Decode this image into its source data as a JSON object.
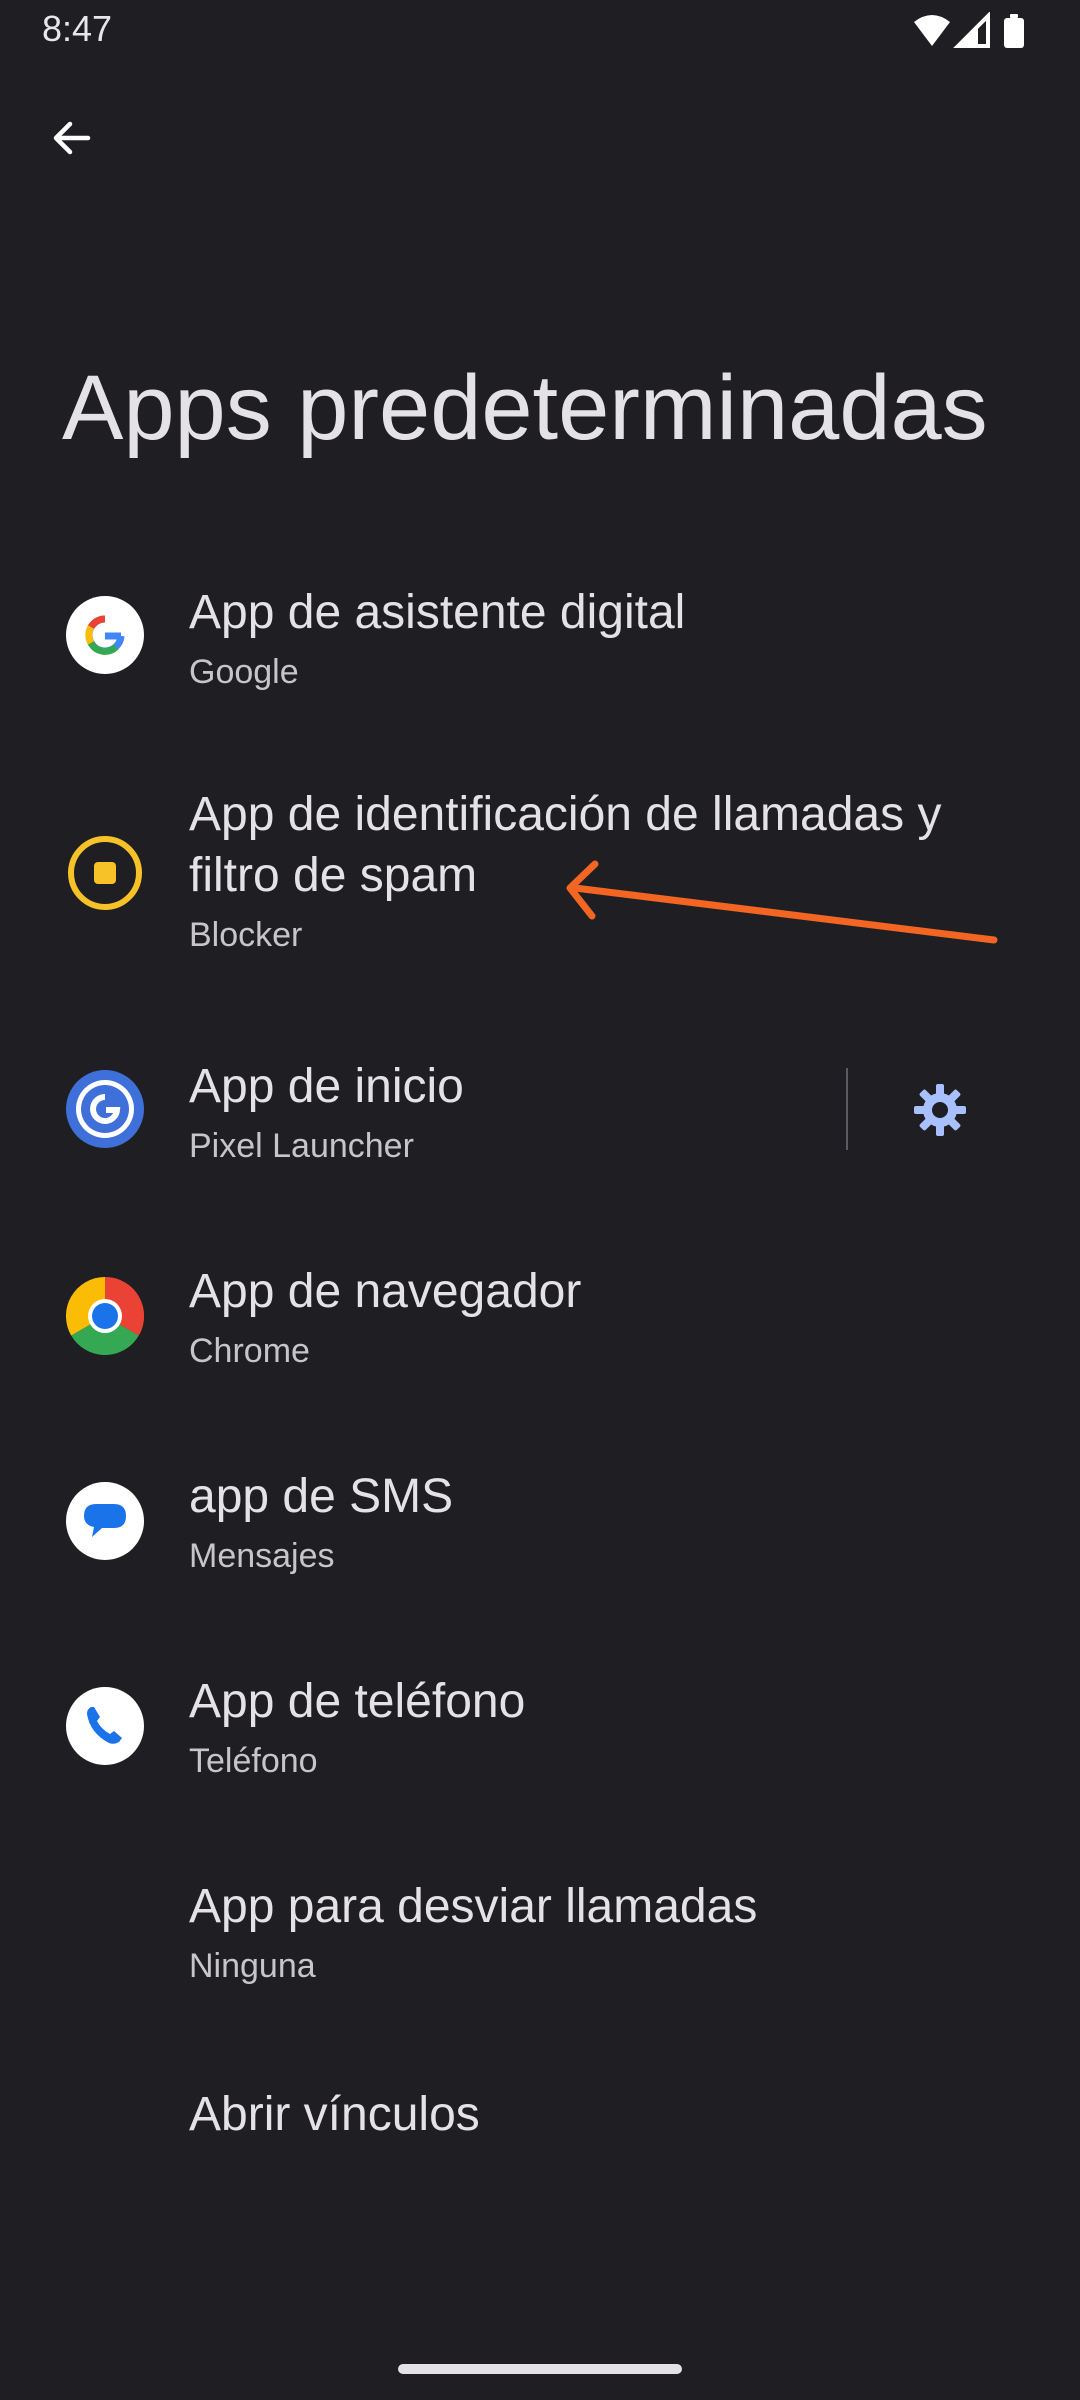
{
  "status_bar": {
    "time": "8:47",
    "icons": [
      "wifi-icon",
      "signal-icon",
      "battery-icon"
    ]
  },
  "header": {
    "back_icon": "arrow-left-icon",
    "title": "Apps predeterminadas"
  },
  "items": [
    {
      "title": "App de asistente digital",
      "subtitle": "Google",
      "icon": "google-icon"
    },
    {
      "title": "App de identificación de llamadas y filtro de spam",
      "subtitle": "Blocker",
      "icon": "blocker-icon"
    },
    {
      "title": "App de inicio",
      "subtitle": "Pixel Launcher",
      "icon": "pixel-launcher-icon",
      "action_icon": "gear-icon"
    },
    {
      "title": "App de navegador",
      "subtitle": "Chrome",
      "icon": "chrome-icon"
    },
    {
      "title": "app de SMS",
      "subtitle": "Mensajes",
      "icon": "messages-icon"
    },
    {
      "title": "App de teléfono",
      "subtitle": "Teléfono",
      "icon": "phone-icon"
    },
    {
      "title": "App para desviar llamadas",
      "subtitle": "Ninguna",
      "icon": ""
    },
    {
      "title": "Abrir vínculos",
      "subtitle": "",
      "icon": ""
    }
  ],
  "colors": {
    "background": "#1f1f23",
    "text_primary": "#e4e2e6",
    "text_secondary": "#c7c5ca",
    "accent_gear": "#a8c0ff",
    "annotation_arrow": "#f26522",
    "blocker_yellow": "#f6c228"
  }
}
